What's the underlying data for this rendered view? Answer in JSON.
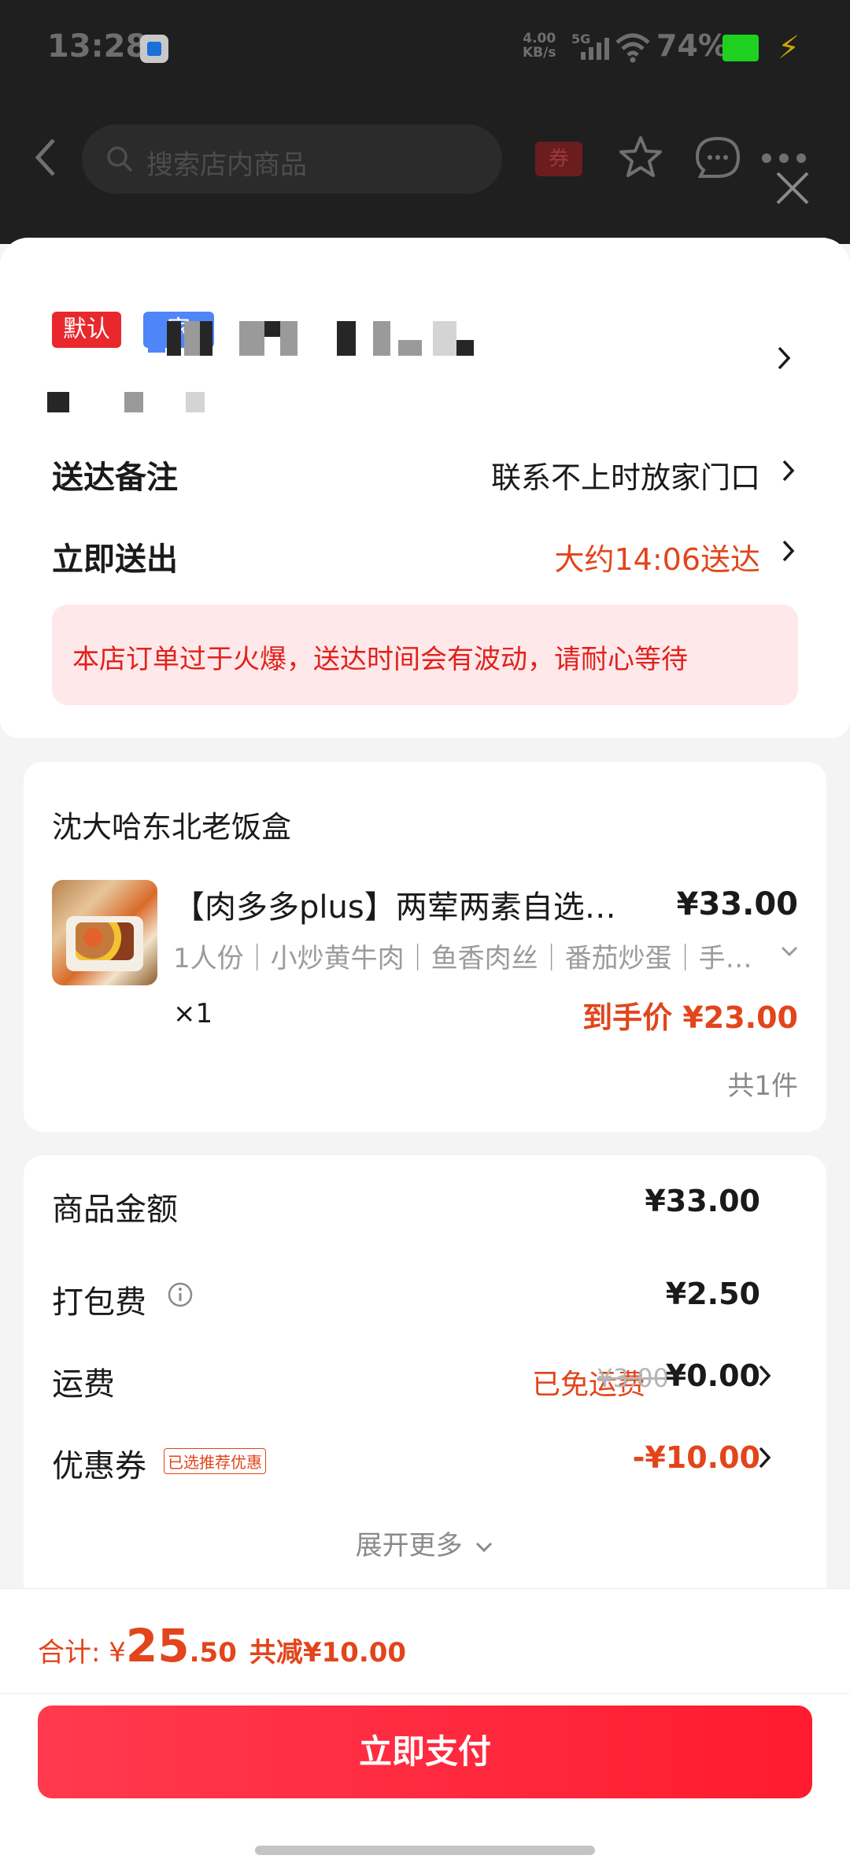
{
  "status_bar": {
    "time": "13:28",
    "net_speed": "4.00\nKB/s",
    "signal_type": "5G",
    "battery_percent": "74%"
  },
  "header": {
    "search_placeholder": "搜索店内商品",
    "coupon_label": "券"
  },
  "address": {
    "default_tag": "默认",
    "home_tag": "家"
  },
  "delivery": {
    "note_label": "送达备注",
    "note_value": "联系不上时放家门口",
    "time_label": "立即送出",
    "time_value": "大约14:06送达",
    "notice": "本店订单过于火爆，送达时间会有波动，请耐心等待"
  },
  "order": {
    "shop_name": "沈大哈东北老饭盒",
    "item": {
      "name": "【肉多多plus】两荤两素自选大…",
      "price": "¥33.00",
      "spec": "1人份｜小炒黄牛肉｜鱼香肉丝｜番茄炒蛋｜手…",
      "qty": "×1",
      "final_price": "到手价 ¥23.00"
    },
    "total_count": "共1件"
  },
  "fees": {
    "goods_label": "商品金额",
    "goods_value": "¥33.00",
    "pack_label": "打包费",
    "pack_value": "¥2.50",
    "delivery_label": "运费",
    "delivery_free": "已免运费",
    "delivery_old": "¥3.00",
    "delivery_value": "¥0.00",
    "coupon_label": "优惠券",
    "coupon_badge": "已选推荐优惠",
    "coupon_value": "-¥10.00",
    "expand": "展开更多"
  },
  "footer": {
    "total_prefix": "合计: ¥",
    "total_int": "25",
    "total_dec": ".50",
    "total_cut": "共减¥10.00",
    "pay_button": "立即支付"
  },
  "colors": {
    "accent": "#e2451c",
    "pay_button": "#ff2a3f",
    "notice_bg": "#ffe8ea",
    "default_tag": "#e8282c",
    "home_tag": "#4f86f7"
  }
}
